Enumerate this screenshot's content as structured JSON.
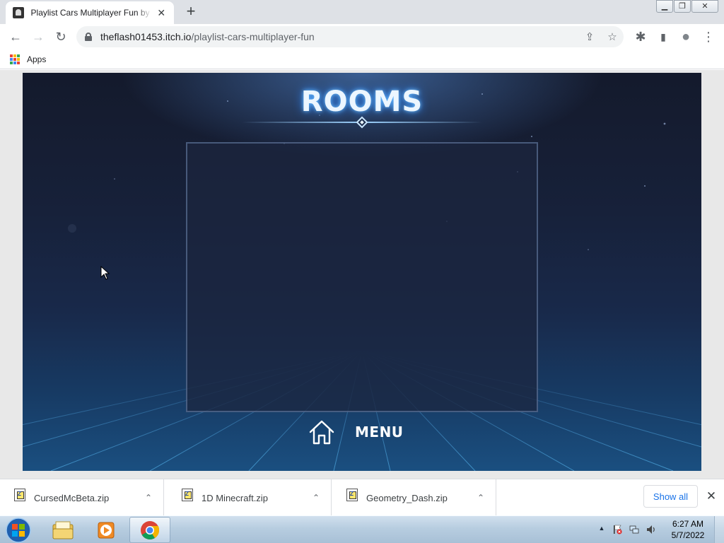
{
  "browser": {
    "tab": {
      "title": "Playlist Cars Multiplayer Fun by T",
      "close": "✕"
    },
    "new_tab": "+",
    "window_controls": {
      "minimize": "▁",
      "restore": "❐",
      "close": "✕"
    },
    "nav": {
      "back": "←",
      "forward": "→",
      "reload": "↻"
    },
    "url": {
      "host": "theflash01453.itch.io",
      "path": "/playlist-cars-multiplayer-fun"
    },
    "omnibox_actions": {
      "share": "⇪",
      "bookmark": "☆"
    },
    "toolbar_icons": {
      "extensions": "✱",
      "side_panel": "▮",
      "profile": "●",
      "menu": "⋮"
    },
    "bookmarks": [
      {
        "label": "Apps",
        "icon": "apps-grid-icon"
      }
    ]
  },
  "game": {
    "title": "ROOMS",
    "menu_label": "MENU",
    "menu_icon": "home-icon"
  },
  "downloads": {
    "items": [
      {
        "name": "CursedMcBeta.zip",
        "chevron": "⌃"
      },
      {
        "name": "1D Minecraft.zip",
        "chevron": "⌃"
      },
      {
        "name": "Geometry_Dash.zip",
        "chevron": "⌃"
      }
    ],
    "show_all": "Show all",
    "close": "✕"
  },
  "taskbar": {
    "pinned": [
      "windows-explorer-icon",
      "media-player-icon",
      "chrome-icon"
    ],
    "tray_arrow": "▲",
    "clock": {
      "time": "6:27 AM",
      "date": "5/7/2022"
    }
  },
  "colors": {
    "accent_blue": "#1a73e8",
    "game_glow": "#6fc1ff",
    "apps_grid": [
      "#ea4335",
      "#fbbc04",
      "#34a853",
      "#4285f4",
      "#ea4335",
      "#fbbc04",
      "#34a853",
      "#4285f4",
      "#ea4335"
    ]
  }
}
